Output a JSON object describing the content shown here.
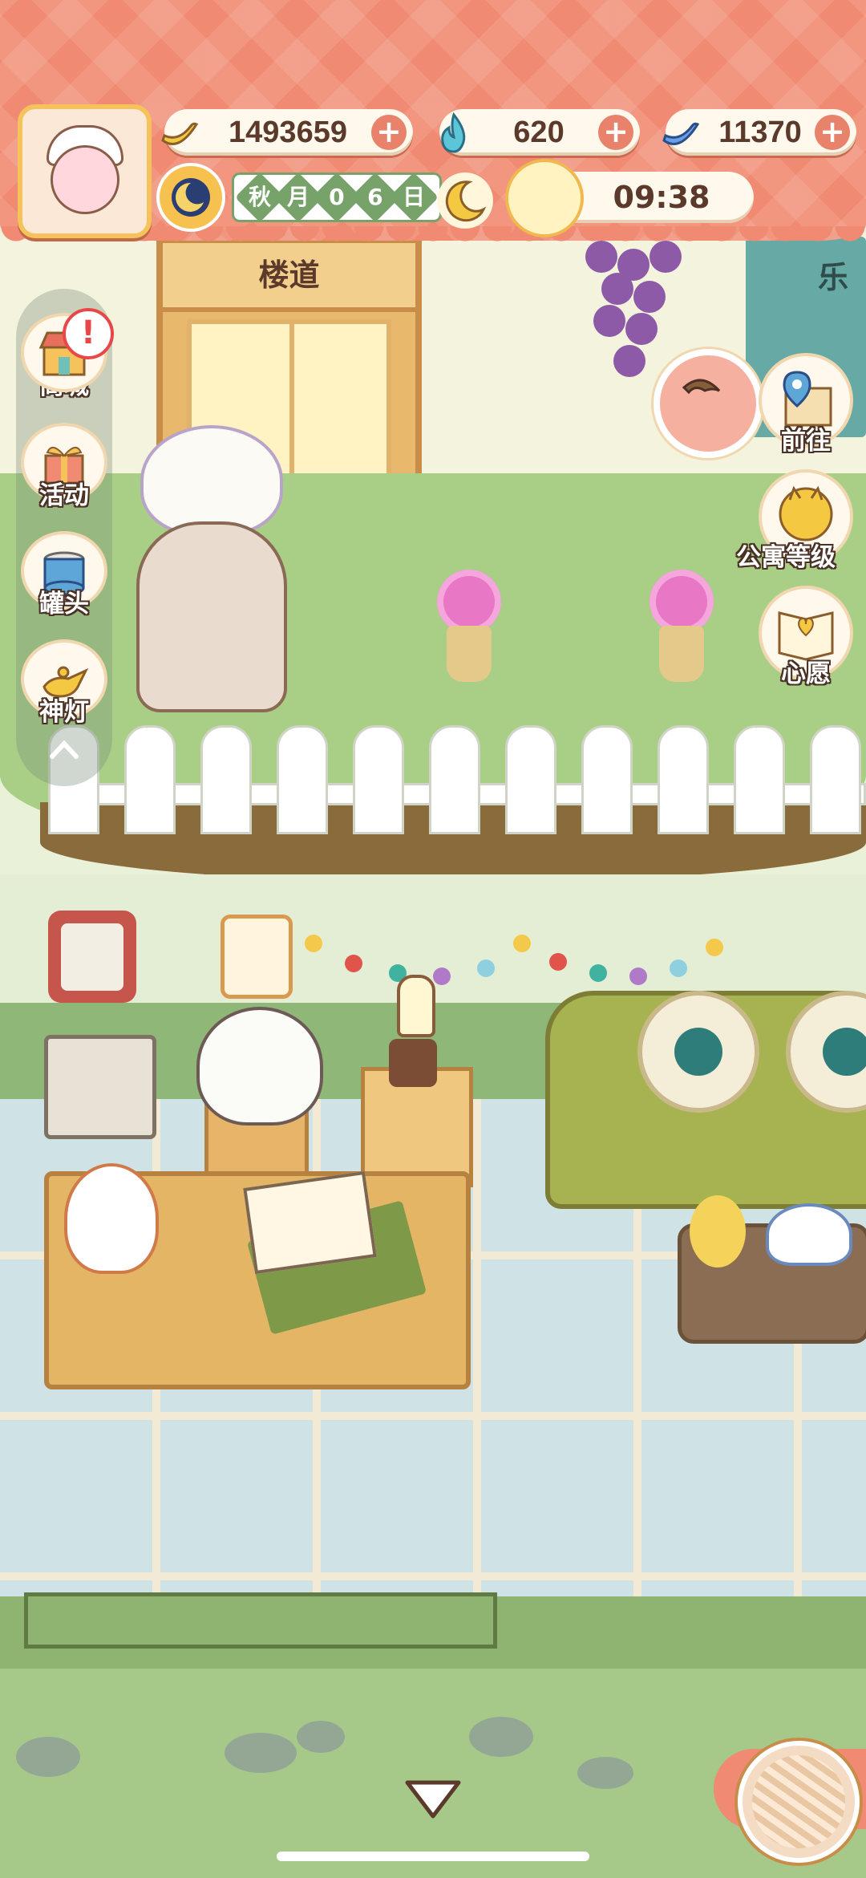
{
  "header": {
    "currencies": [
      {
        "icon": "banana-icon",
        "value": "1493659"
      },
      {
        "icon": "blue-flame-icon",
        "value": "620"
      },
      {
        "icon": "blue-banana-icon",
        "value": "11370"
      }
    ],
    "date": {
      "chars": [
        "秋",
        "月",
        "0",
        "6",
        "日"
      ]
    },
    "clock": "09:38"
  },
  "scene": {
    "door_sign": "楼道",
    "right_sign": "乐"
  },
  "left_menu": [
    {
      "label": "商城",
      "icon": "shop-icon",
      "alert": "!"
    },
    {
      "label": "活动",
      "icon": "gift-icon"
    },
    {
      "label": "罐头",
      "icon": "can-icon"
    },
    {
      "label": "神灯",
      "icon": "magic-lamp-icon"
    }
  ],
  "right_menu": [
    {
      "label": "前往",
      "icon": "map-pin-icon"
    },
    {
      "label": "公寓等级",
      "icon": "cat-level-icon"
    },
    {
      "label": "心愿",
      "icon": "wish-book-icon"
    }
  ],
  "colors": {
    "banner": "#f08a72",
    "accent": "#f5c25c",
    "text_dark": "#5b3a2c"
  }
}
